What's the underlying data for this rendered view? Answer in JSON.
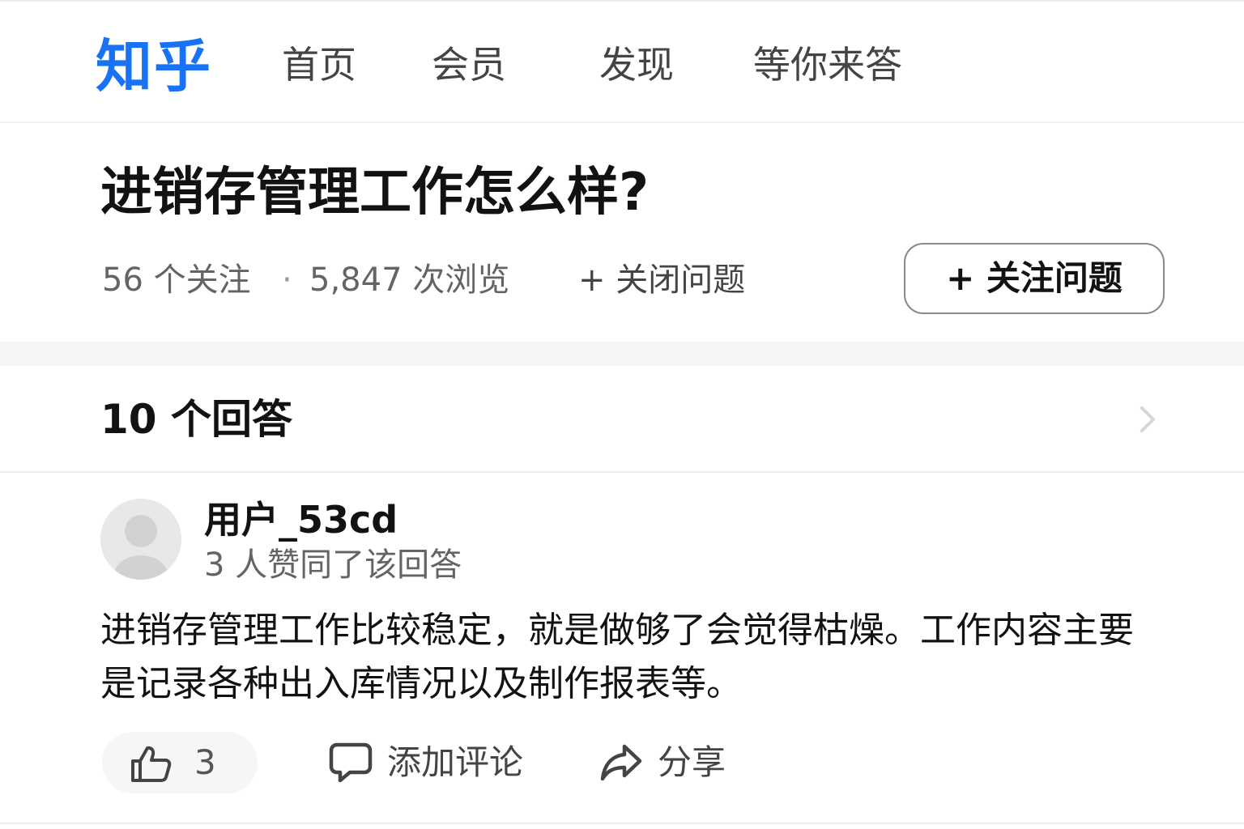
{
  "nav": {
    "logo": "知乎",
    "items": [
      {
        "label": "首页"
      },
      {
        "label": "会员"
      },
      {
        "label": "发现"
      },
      {
        "label": "等你来答"
      }
    ]
  },
  "question": {
    "title": "进销存管理工作怎么样?",
    "followers": "56 个关注",
    "separator": "·",
    "views": "5,847 次浏览",
    "close_label": "+ 关闭问题",
    "follow_button": "+ 关注问题"
  },
  "answers": {
    "count_label": "10 个回答"
  },
  "answer": {
    "author": "用户_53cd",
    "vote_info": "3 人赞同了该回答",
    "content": "进销存管理工作比较稳定，就是做够了会觉得枯燥。工作内容主要是记录各种出入库情况以及制作报表等。",
    "like_count": "3",
    "comment_label": "添加评论",
    "share_label": "分享"
  },
  "colors": {
    "brand": "#1772f6",
    "text": "#121212",
    "muted": "#646464"
  },
  "icons": {
    "like": "thumbs-up-icon",
    "comment": "comment-bubble-icon",
    "share": "share-arrow-icon",
    "chevron": "chevron-right-icon",
    "avatar": "default-avatar-icon"
  }
}
